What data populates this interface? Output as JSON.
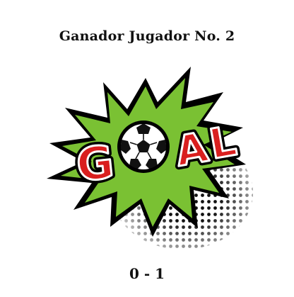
{
  "header": {
    "title": "Ganador Jugador No. 2"
  },
  "graphic": {
    "word": "GOAL",
    "icon": "soccer-ball-icon",
    "burst_color": "#7ac133",
    "letter_color": "#d91f1f",
    "outline_color": "#000000"
  },
  "footer": {
    "score": "0 - 1"
  }
}
